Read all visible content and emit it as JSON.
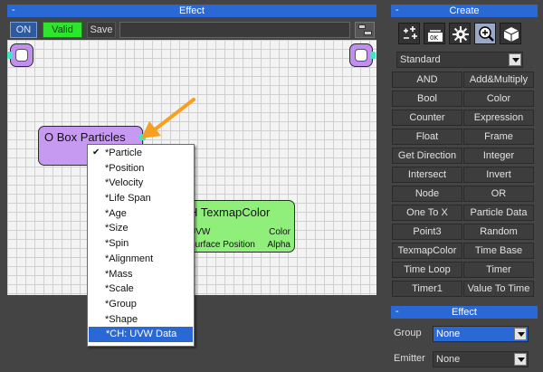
{
  "effect_panel": {
    "title": "Effect",
    "minimize": "-",
    "toolbar": {
      "on_label": "ON",
      "valid_label": "Valid",
      "save_label": "Save",
      "name_value": ""
    }
  },
  "nodes": {
    "particles": {
      "title": "O Box Particles"
    },
    "texmap": {
      "title": "H TexmapColor",
      "inputs": [
        "UVW",
        "Surface Position"
      ],
      "outputs": [
        "Color",
        "Alpha"
      ]
    }
  },
  "context_menu": {
    "items": [
      {
        "label": "*Particle",
        "checked": true
      },
      {
        "label": "*Position"
      },
      {
        "label": "*Velocity"
      },
      {
        "label": "*Life Span"
      },
      {
        "label": "*Age"
      },
      {
        "label": "*Size"
      },
      {
        "label": "*Spin"
      },
      {
        "label": "*Alignment"
      },
      {
        "label": "*Mass"
      },
      {
        "label": "*Scale"
      },
      {
        "label": "*Group"
      },
      {
        "label": "*Shape"
      },
      {
        "label": "*CH: UVW Data",
        "selected": true
      }
    ]
  },
  "create_panel": {
    "title": "Create",
    "minimize": "-",
    "icons": [
      "add-node-icon",
      "counter-icon",
      "gear-icon",
      "zoom-icon",
      "box-icon"
    ],
    "category_select": "Standard",
    "buttons": [
      "AND",
      "Add&Multiply",
      "Bool",
      "Color",
      "Counter",
      "Expression",
      "Float",
      "Frame",
      "Get Direction",
      "Integer",
      "Intersect",
      "Invert",
      "Node",
      "OR",
      "One To X",
      "Particle Data",
      "Point3",
      "Random",
      "TexmapColor",
      "Time Base",
      "Time Loop",
      "Timer",
      "Timer1",
      "Value To Time"
    ]
  },
  "effect_props": {
    "title": "Effect",
    "minimize": "-",
    "group_label": "Group",
    "group_value": "None",
    "emitter_label": "Emitter",
    "emitter_value": "None"
  },
  "colors": {
    "accent": "#2a68d6",
    "valid_green": "#2ee52e",
    "particle_node": "#c79af2",
    "texmap_node": "#8fef7a",
    "arrow": "#f5a020"
  }
}
